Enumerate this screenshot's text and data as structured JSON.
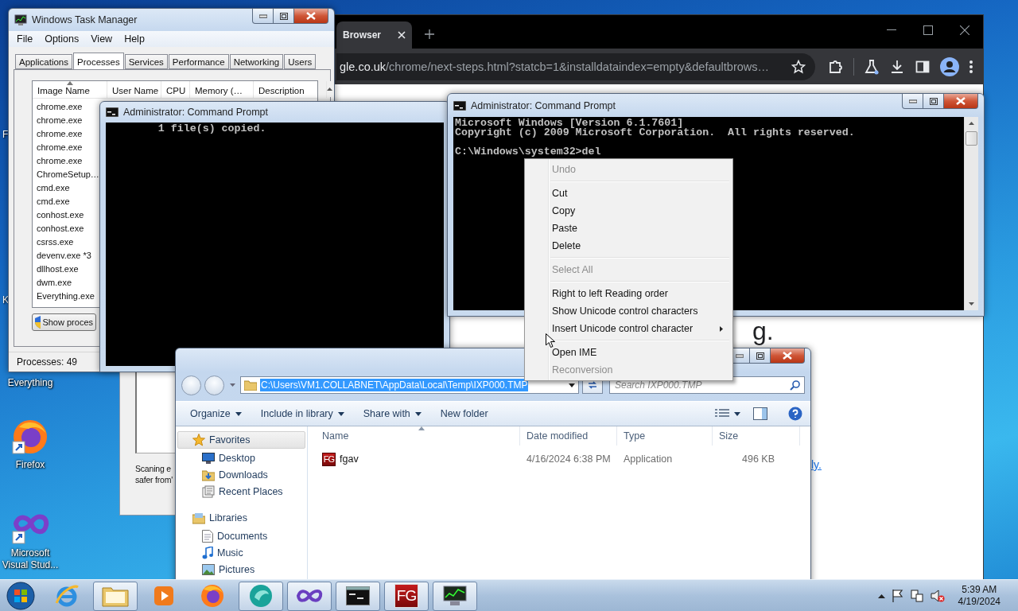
{
  "desktop": {
    "edge_labels": [
      "F",
      "K"
    ],
    "icons": [
      {
        "label": "Everything"
      },
      {
        "label": "Firefox",
        "kind": "firefox"
      },
      {
        "label": "Microsoft Visual Stud...",
        "kind": "vs"
      }
    ]
  },
  "chrome": {
    "tab_title": "Browser",
    "address_host": "gle.co.uk",
    "address_path": "/chrome/next-steps.html?statcb=1&installdataindex=empty&defaultbrows…",
    "heading_fragment": "g.",
    "link_fragment": "ly."
  },
  "task_manager": {
    "title": "Windows Task Manager",
    "menu": [
      "File",
      "Options",
      "View",
      "Help"
    ],
    "tabs": [
      {
        "label": "Applications",
        "selected": false
      },
      {
        "label": "Processes",
        "selected": true
      },
      {
        "label": "Services",
        "selected": false
      },
      {
        "label": "Performance",
        "selected": false
      },
      {
        "label": "Networking",
        "selected": false
      },
      {
        "label": "Users",
        "selected": false
      }
    ],
    "columns": [
      {
        "label": "Image Name",
        "sorted": true
      },
      {
        "label": "User Name",
        "sorted": false
      },
      {
        "label": "CPU",
        "sorted": false
      },
      {
        "label": "Memory (…",
        "sorted": false
      },
      {
        "label": "Description",
        "sorted": false
      }
    ],
    "processes": [
      "chrome.exe",
      "chrome.exe",
      "chrome.exe",
      "chrome.exe",
      "chrome.exe",
      "ChromeSetup…",
      "cmd.exe",
      "cmd.exe",
      "conhost.exe",
      "conhost.exe",
      "csrss.exe",
      "devenv.exe *3",
      "dllhost.exe",
      "dwm.exe",
      "Everything.exe"
    ],
    "button": "Show proces",
    "status": "Processes: 49"
  },
  "scan_dialog": {
    "lines": [
      "Scaning e",
      "safer from'"
    ]
  },
  "console_1": {
    "title": "Administrator:  Command Prompt",
    "lines": [
      "1 file(s) copied."
    ]
  },
  "console_2": {
    "title": "Administrator:  Command Prompt",
    "lines": [
      "Microsoft Windows [Version 6.1.7601]",
      "Copyright (c) 2009 Microsoft Corporation.  All rights reserved."
    ],
    "prompt": "C:\\Windows\\system32>del"
  },
  "explorer": {
    "path": "C:\\Users\\VM1.COLLABNET\\AppData\\Local\\Temp\\IXP000.TMP",
    "path_selected": true,
    "search_placeholder": "Search IXP000.TMP",
    "toolbar": [
      {
        "label": "Organize",
        "menu": true
      },
      {
        "label": "Include in library",
        "menu": true
      },
      {
        "label": "Share with",
        "menu": true
      },
      {
        "label": "New folder",
        "menu": false
      }
    ],
    "nav": [
      {
        "label": "Favorites",
        "kind": "star",
        "selected": true,
        "children": [
          {
            "label": "Desktop",
            "kind": "desktop",
            "selected": false
          },
          {
            "label": "Downloads",
            "kind": "downloads",
            "selected": false
          },
          {
            "label": "Recent Places",
            "kind": "places",
            "selected": false
          }
        ]
      },
      {
        "label": "Libraries",
        "kind": "library",
        "selected": false,
        "children": [
          {
            "label": "Documents",
            "kind": "documents",
            "selected": false
          },
          {
            "label": "Music",
            "kind": "music",
            "selected": false
          },
          {
            "label": "Pictures",
            "kind": "pictures",
            "selected": false
          }
        ]
      }
    ],
    "columns": [
      {
        "label": "Name",
        "sorted": true
      },
      {
        "label": "Date modified",
        "sorted": false
      },
      {
        "label": "Type",
        "sorted": false
      },
      {
        "label": "Size",
        "sorted": false
      }
    ],
    "files": [
      {
        "name": "fgav",
        "badge": "FG",
        "modified": "4/16/2024 6:38 PM",
        "type": "Application",
        "size": "496 KB"
      }
    ]
  },
  "context_menu": {
    "items": [
      {
        "kind": "item",
        "label": "Undo",
        "disabled": true
      },
      {
        "kind": "separator"
      },
      {
        "kind": "item",
        "label": "Cut",
        "disabled": false
      },
      {
        "kind": "item",
        "label": "Copy",
        "disabled": false
      },
      {
        "kind": "item",
        "label": "Paste",
        "disabled": false
      },
      {
        "kind": "item",
        "label": "Delete",
        "disabled": false
      },
      {
        "kind": "separator"
      },
      {
        "kind": "item",
        "label": "Select All",
        "disabled": true
      },
      {
        "kind": "separator"
      },
      {
        "kind": "item",
        "label": "Right to left Reading order",
        "disabled": false
      },
      {
        "kind": "item",
        "label": "Show Unicode control characters",
        "disabled": false
      },
      {
        "kind": "submenu",
        "label": "Insert Unicode control character",
        "disabled": false
      },
      {
        "kind": "separator"
      },
      {
        "kind": "item",
        "label": "Open IME",
        "disabled": false
      },
      {
        "kind": "item",
        "label": "Reconversion",
        "disabled": true
      }
    ]
  },
  "taskbar": {
    "apps": [
      {
        "kind": "ie",
        "open": false
      },
      {
        "kind": "explorer",
        "open": true
      },
      {
        "kind": "media",
        "open": false
      },
      {
        "kind": "firefox",
        "open": false
      },
      {
        "kind": "teal",
        "open": true
      },
      {
        "kind": "vs",
        "open": true
      },
      {
        "kind": "cmd",
        "open": true
      },
      {
        "kind": "fg",
        "open": true,
        "badge": "FG"
      },
      {
        "kind": "taskmgr",
        "open": true
      }
    ],
    "time": "5:39 AM",
    "date": "4/19/2024"
  }
}
